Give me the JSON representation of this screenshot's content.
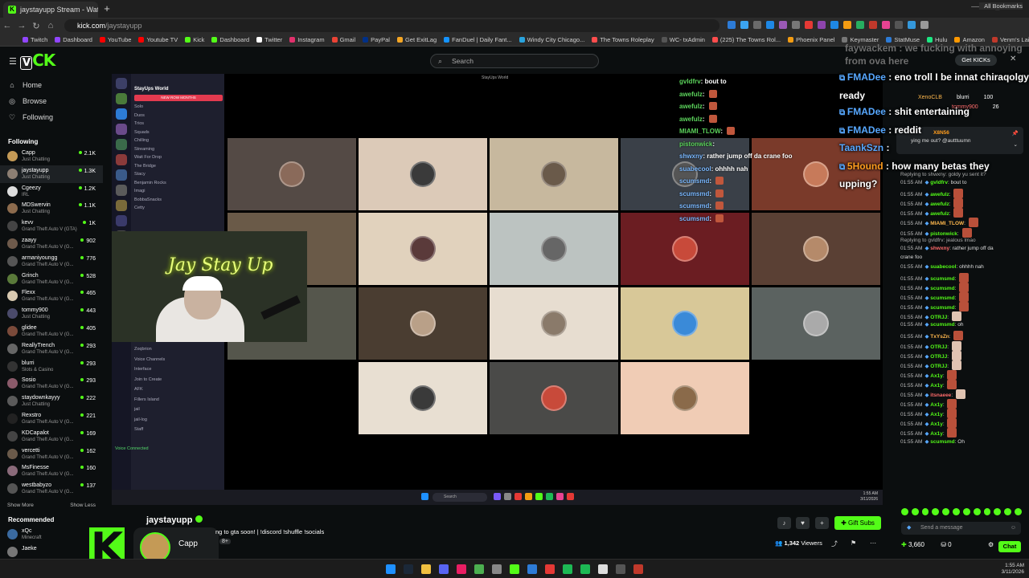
{
  "browser": {
    "tab_title": "jaystayupp Stream - Watch Liv",
    "tab_close": "×",
    "new_tab": "+",
    "url_host": "kick.com",
    "url_path": "/jaystayupp",
    "bookmarks": [
      "Twitch",
      "Dashboard",
      "YouTube",
      "Youtube TV",
      "Kick",
      "Dashboard",
      "Twitter",
      "Instagram",
      "Gmail",
      "PayPal",
      "Get ExitLag",
      "FanDuel | Daily Fant...",
      "Windy City Chicago...",
      "The Towns Roleplay",
      "WC- txAdmin",
      "(225) The Towns Rol...",
      "Phoenix Panel",
      "Keymaster",
      "StatMuse",
      "Hulu",
      "Amazon",
      "Venm's Lair: PS2 Va..."
    ],
    "all_bookmarks": "All Bookmarks"
  },
  "header": {
    "search_placeholder": "Search",
    "get_kicks": "Get KICKs"
  },
  "sidebar": {
    "nav": [
      {
        "label": "Home",
        "icon": "home-icon"
      },
      {
        "label": "Browse",
        "icon": "compass-icon"
      },
      {
        "label": "Following",
        "icon": "heart-icon"
      }
    ],
    "following_label": "Following",
    "following": [
      {
        "name": "Capp",
        "category": "Just Chatting",
        "viewers": "2.1K",
        "color": "#c49a56"
      },
      {
        "name": "jaystayupp",
        "category": "Just Chatting",
        "viewers": "1.3K",
        "color": "#8d7f73"
      },
      {
        "name": "Cgeezy",
        "category": "IRL",
        "viewers": "1.2K",
        "color": "#ddd"
      },
      {
        "name": "MDSwervin",
        "category": "Just Chatting",
        "viewers": "1.1K",
        "color": "#8c6b4d"
      },
      {
        "name": "kevv",
        "category": "Grand Theft Auto V (GTA)",
        "viewers": "1K",
        "color": "#444"
      },
      {
        "name": "zaayy",
        "category": "Grand Theft Auto V (G...",
        "viewers": "902",
        "color": "#6e5a4b"
      },
      {
        "name": "armaniyoungg",
        "category": "Grand Theft Auto V (G...",
        "viewers": "776",
        "color": "#555"
      },
      {
        "name": "Grinch",
        "category": "Grand Theft Auto V (G...",
        "viewers": "528",
        "color": "#5a7a3a"
      },
      {
        "name": "Flexx",
        "category": "Grand Theft Auto V (G...",
        "viewers": "465",
        "color": "#d8c9b0"
      },
      {
        "name": "tommy900",
        "category": "Just Chatting",
        "viewers": "443",
        "color": "#4a4a6a"
      },
      {
        "name": "glidee",
        "category": "Grand Theft Auto V (G...",
        "viewers": "405",
        "color": "#7a4a3a"
      },
      {
        "name": "ReallyTrench",
        "category": "Grand Theft Auto V (G...",
        "viewers": "293",
        "color": "#666"
      },
      {
        "name": "blurri",
        "category": "Slots & Casino",
        "viewers": "293",
        "color": "#333"
      },
      {
        "name": "Sosio",
        "category": "Grand Theft Auto V (G...",
        "viewers": "293",
        "color": "#8a5a6a"
      },
      {
        "name": "staydownkayyy",
        "category": "Just Chatting",
        "viewers": "222",
        "color": "#5a5a5a"
      },
      {
        "name": "Rexstro",
        "category": "Grand Theft Auto V (G...",
        "viewers": "221",
        "color": "#222"
      },
      {
        "name": "KDCapalot",
        "category": "Grand Theft Auto V (G...",
        "viewers": "169",
        "color": "#444"
      },
      {
        "name": "vercetti",
        "category": "Grand Theft Auto V (G...",
        "viewers": "162",
        "color": "#6a5a4a"
      },
      {
        "name": "MsFinesse",
        "category": "Grand Theft Auto V (G...",
        "viewers": "160",
        "color": "#8a6a7a"
      },
      {
        "name": "westbabyzo",
        "category": "Grand Theft Auto V (G...",
        "viewers": "137",
        "color": "#555"
      }
    ],
    "show_more": "Show More",
    "show_less": "Show Less",
    "recommended_label": "Recommended",
    "recommended": [
      {
        "name": "xQc",
        "category": "Minecraft",
        "color": "#3a6aa0"
      },
      {
        "name": "Jaeke",
        "category": "",
        "color": "#777"
      }
    ]
  },
  "stream": {
    "discord_server": "StayUps World",
    "discord_channels": [
      "Solo",
      "Duos",
      "Trios",
      "Squads",
      "Chilling",
      "Streaming",
      "Wait For Drop",
      "The Bridge",
      "Stacy",
      "Benjamin Rocks",
      "Imagi",
      "BobbaSnacks",
      "Cetty"
    ],
    "discord_header": "StayUps World",
    "discord_lower": [
      "Zoqbrion",
      "Voice Channels",
      "Interface",
      "Join to Create",
      "AFK",
      "Fillers Island",
      "jail",
      "jail-log",
      "Staff"
    ],
    "voice_connected": "Voice Connected",
    "cam_sign": "Jay Stay Up",
    "overlay_chat": [
      {
        "user": "gvldfrv",
        "text": "bout to",
        "emote": false
      },
      {
        "user": "awefulz",
        "text": "",
        "emote": true
      },
      {
        "user": "awefulz",
        "text": "",
        "emote": true
      },
      {
        "user": "awefulz",
        "text": "",
        "emote": true
      },
      {
        "user": "MIAMI_TLOW",
        "text": "",
        "emote": true
      },
      {
        "user": "pistonwick",
        "text": "",
        "emote": false
      },
      {
        "user": "shwxny",
        "text": "rather jump off da crane foo",
        "emote": false
      },
      {
        "user": "suabecool",
        "text": "ohhhh nah",
        "emote": false
      },
      {
        "user": "scumsmd",
        "text": "",
        "emote": true
      },
      {
        "user": "scumsmd",
        "text": "",
        "emote": true
      },
      {
        "user": "scumsmd",
        "text": "",
        "emote": true
      },
      {
        "user": "scumsmd",
        "text": "",
        "emote": true
      }
    ],
    "taskbar_search": "Search",
    "taskbar_time": "1:55 AM",
    "taskbar_date": "3/11/2026"
  },
  "big_overlay": {
    "ghost": [
      "faywackem : we fucking with annoying",
      "from ova here"
    ],
    "lines": [
      {
        "user": "FMADee",
        "text": "eno troll I be innat chiraqolgy ready"
      },
      {
        "user": "FMADee",
        "text": "shit entertaining"
      },
      {
        "user": "FMADee",
        "text": "reddit"
      },
      {
        "user": "TaankSzn",
        "text": ""
      },
      {
        "user": "5Hound",
        "text": "how many betas they upping?"
      }
    ]
  },
  "chat": {
    "leaderboard": [
      {
        "name": "XenoCLB",
        "value": ""
      },
      {
        "name": "blurri",
        "value": "100"
      },
      {
        "name": "tommy900",
        "value": "26"
      }
    ],
    "pinned_user": "X8N56",
    "pinned_text": "ying me out? @autttuumn",
    "messages": [
      {
        "reply": "Replying to shwxny: goldy yu sent it?",
        "time": "",
        "user": "",
        "text": "",
        "emote": false
      },
      {
        "reply": "",
        "time": "01:55 AM",
        "user": "gvldfrv",
        "text": "bout to",
        "emote": false
      },
      {
        "reply": "",
        "time": "01:55 AM",
        "user": "awefulz",
        "text": "",
        "emote": true
      },
      {
        "reply": "",
        "time": "01:55 AM",
        "user": "awefulz",
        "text": "",
        "emote": true
      },
      {
        "reply": "",
        "time": "01:55 AM",
        "user": "awefulz",
        "text": "",
        "emote": true
      },
      {
        "reply": "",
        "time": "01:55 AM",
        "user": "MIAMI_TLOW",
        "text": "",
        "emote": true
      },
      {
        "reply": "",
        "time": "01:55 AM",
        "user": "pistonwick",
        "text": "",
        "emote": true
      },
      {
        "reply": "Replying to gvldfrv: jealous lmao",
        "time": "",
        "user": "",
        "text": "",
        "emote": false
      },
      {
        "reply": "",
        "time": "01:55 AM",
        "user": "shwxny",
        "text": "rather jump off da",
        "emote": false
      },
      {
        "reply": "",
        "time": "",
        "user": "",
        "text": "crane foo",
        "emote": false
      },
      {
        "reply": "",
        "time": "01:55 AM",
        "user": "suabecool",
        "text": "ohhhh nah",
        "emote": false
      },
      {
        "reply": "",
        "time": "01:55 AM",
        "user": "scumsmd",
        "text": "",
        "emote": true
      },
      {
        "reply": "",
        "time": "01:55 AM",
        "user": "scumsmd",
        "text": "",
        "emote": true
      },
      {
        "reply": "",
        "time": "01:55 AM",
        "user": "scumsmd",
        "text": "",
        "emote": true
      },
      {
        "reply": "",
        "time": "01:55 AM",
        "user": "scumsmd",
        "text": "",
        "emote": true
      },
      {
        "reply": "",
        "time": "01:55 AM",
        "user": "OTRJJ",
        "text": "",
        "emote": true
      },
      {
        "reply": "",
        "time": "01:55 AM",
        "user": "scumsmd",
        "text": "oh",
        "emote": false
      },
      {
        "reply": "",
        "time": "01:55 AM",
        "user": "TxYsZn",
        "text": "",
        "emote": true
      },
      {
        "reply": "",
        "time": "01:55 AM",
        "user": "OTRJJ",
        "text": "",
        "emote": true
      },
      {
        "reply": "",
        "time": "01:55 AM",
        "user": "OTRJJ",
        "text": "",
        "emote": true
      },
      {
        "reply": "",
        "time": "01:55 AM",
        "user": "OTRJJ",
        "text": "",
        "emote": true
      },
      {
        "reply": "",
        "time": "01:55 AM",
        "user": "Ax1y",
        "text": "",
        "emote": true
      },
      {
        "reply": "",
        "time": "01:55 AM",
        "user": "Ax1y",
        "text": "",
        "emote": true
      },
      {
        "reply": "",
        "time": "01:55 AM",
        "user": "itsnaeee",
        "text": "",
        "emote": true
      },
      {
        "reply": "",
        "time": "01:55 AM",
        "user": "Ax1y",
        "text": "",
        "emote": true
      },
      {
        "reply": "",
        "time": "01:55 AM",
        "user": "Ax1y",
        "text": "",
        "emote": true
      },
      {
        "reply": "",
        "time": "01:55 AM",
        "user": "Ax1y",
        "text": "",
        "emote": true
      },
      {
        "reply": "",
        "time": "01:55 AM",
        "user": "Ax1y",
        "text": "",
        "emote": true
      },
      {
        "reply": "",
        "time": "01:55 AM",
        "user": "scumsmd",
        "text": "Oh",
        "emote": false
      }
    ],
    "send_placeholder": "Send a message",
    "kicks_count": "3,660",
    "other_count": "0",
    "chat_button": "Chat"
  },
  "info": {
    "channel_name": "jaystayupp",
    "title": "ng to gta soon! | !discord !shuffle !socials",
    "category_tag": "8+",
    "co_streamer": "Capp",
    "viewers_count": "1,342",
    "viewers_label": "Viewers",
    "gift_subs": "Gift Subs"
  },
  "windows": {
    "time": "1:55 AM",
    "date": "3/11/2026"
  },
  "colors": {
    "kick_green": "#53fc18",
    "background": "#0b0e0f"
  }
}
